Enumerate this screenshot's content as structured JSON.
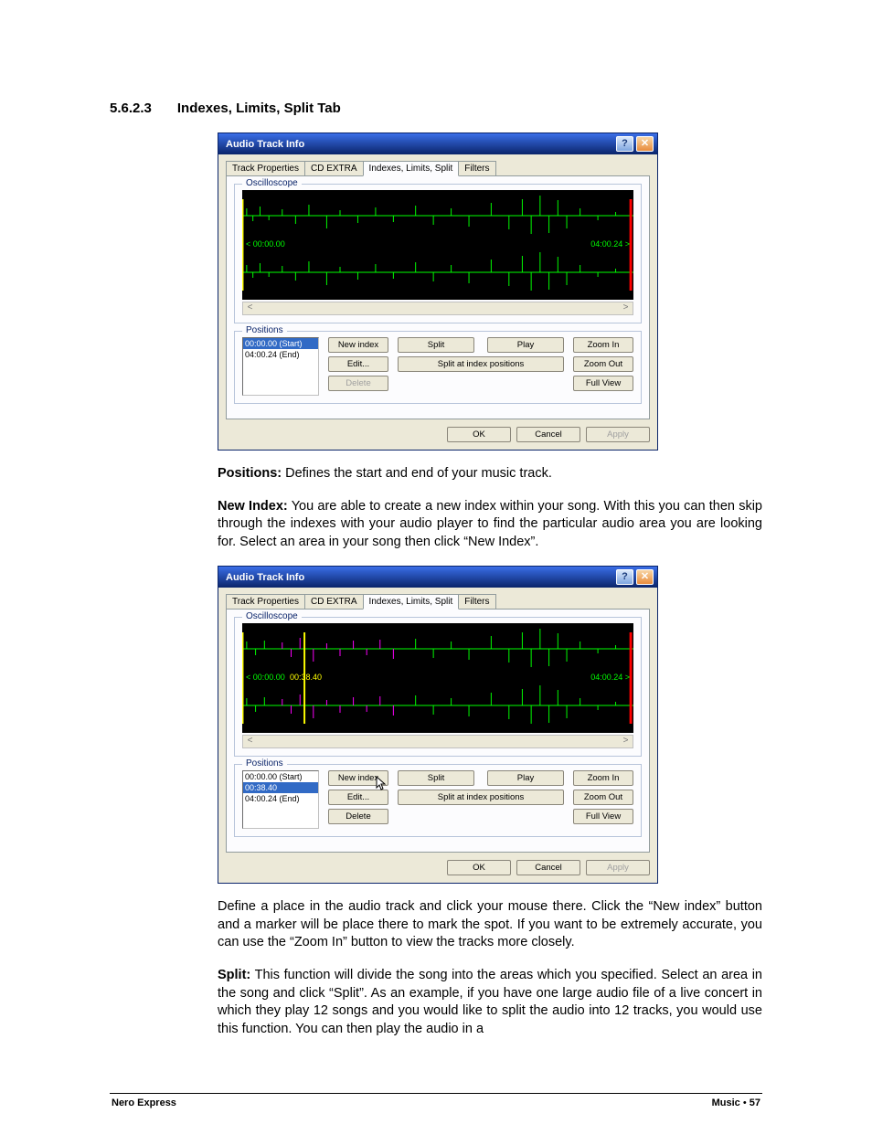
{
  "section": {
    "number": "5.6.2.3",
    "title": "Indexes, Limits, Split Tab"
  },
  "paragraphs": {
    "positions_label": "Positions:",
    "positions_text": " Defines the start and end of your music track.",
    "newindex_label": "New Index:",
    "newindex_text": " You are able to create a new index within your song. With this you can then skip through the indexes with your audio player to find the particular audio area you are looking for. Select an area in your song then click “New Index”.",
    "define_text": "Define a place in the audio track and click your mouse there. Click the “New index” button and a marker will be place there to mark the spot. If you want to be extremely accurate, you can use the “Zoom In” button to view the tracks more closely.",
    "split_label": "Split:",
    "split_text": " This function will divide the song into the areas which you specified. Select an area in the song and click “Split”. As an example, if you have one large audio file of a live concert in which they play 12 songs and you would like to split the audio into 12 tracks, you would use this function. You can then play the audio in a"
  },
  "dialog": {
    "title": "Audio Track Info",
    "help_glyph": "?",
    "close_glyph": "✕",
    "tabs": {
      "track_properties": "Track Properties",
      "cd_extra": "CD EXTRA",
      "indexes": "Indexes, Limits, Split",
      "filters": "Filters"
    },
    "oscilloscope_label": "Oscilloscope",
    "time_start": "< 00:00.00",
    "time_end": "04:00.24 >",
    "positions_label": "Positions",
    "scroll_left": "<",
    "scroll_right": ">",
    "buttons": {
      "new_index": "New index",
      "split": "Split",
      "play": "Play",
      "zoom_in": "Zoom In",
      "edit": "Edit...",
      "split_at_index": "Split at index positions",
      "zoom_out": "Zoom Out",
      "delete": "Delete",
      "full_view": "Full View",
      "ok": "OK",
      "cancel": "Cancel",
      "apply": "Apply"
    }
  },
  "dialog1_positions": {
    "item1": "00:00.00 (Start)",
    "item2": "04:00.24 (End)"
  },
  "dialog2": {
    "time_mid": "00:38.40",
    "positions": {
      "item1": "00:00.00 (Start)",
      "item2": "00:38.40",
      "item3": "04:00.24 (End)"
    }
  },
  "footer": {
    "left": "Nero Express",
    "right_label": "Music",
    "dot": " • ",
    "page": "57"
  }
}
